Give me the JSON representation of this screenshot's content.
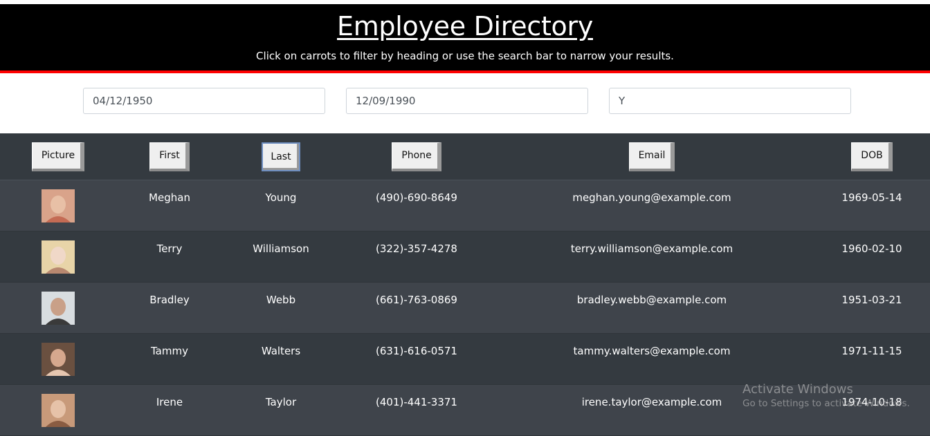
{
  "header": {
    "title": "Employee Directory",
    "subtitle": "Click on carrots to filter by heading or use the search bar to narrow your results."
  },
  "search": {
    "start_date": "04/12/1950",
    "end_date": "12/09/1990",
    "name_filter": "Y"
  },
  "columns": {
    "picture": "Picture",
    "first": "First",
    "last": "Last",
    "phone": "Phone",
    "email": "Email",
    "dob": "DOB"
  },
  "rows": [
    {
      "first": "Meghan",
      "last": "Young",
      "phone": "(490)-690-8649",
      "email": "meghan.young@example.com",
      "dob": "1969-05-14",
      "avatar_colors": [
        "#d9a38a",
        "#e8c0a6",
        "#c46b54"
      ]
    },
    {
      "first": "Terry",
      "last": "Williamson",
      "phone": "(322)-357-4278",
      "email": "terry.williamson@example.com",
      "dob": "1960-02-10",
      "avatar_colors": [
        "#e8d4a8",
        "#f0d8c8",
        "#b88870"
      ]
    },
    {
      "first": "Bradley",
      "last": "Webb",
      "phone": "(661)-763-0869",
      "email": "bradley.webb@example.com",
      "dob": "1951-03-21",
      "avatar_colors": [
        "#d8dde0",
        "#c9a088",
        "#3a3a3a"
      ]
    },
    {
      "first": "Tammy",
      "last": "Walters",
      "phone": "(631)-616-0571",
      "email": "tammy.walters@example.com",
      "dob": "1971-11-15",
      "avatar_colors": [
        "#6a5040",
        "#d6a88e",
        "#e6c6b0"
      ]
    },
    {
      "first": "Irene",
      "last": "Taylor",
      "phone": "(401)-441-3371",
      "email": "irene.taylor@example.com",
      "dob": "1974-10-18",
      "avatar_colors": [
        "#c89a7a",
        "#e6c2a8",
        "#8a5c42"
      ]
    }
  ],
  "watermark": {
    "line1": "Activate Windows",
    "line2": "Go to Settings to activate Windows."
  }
}
